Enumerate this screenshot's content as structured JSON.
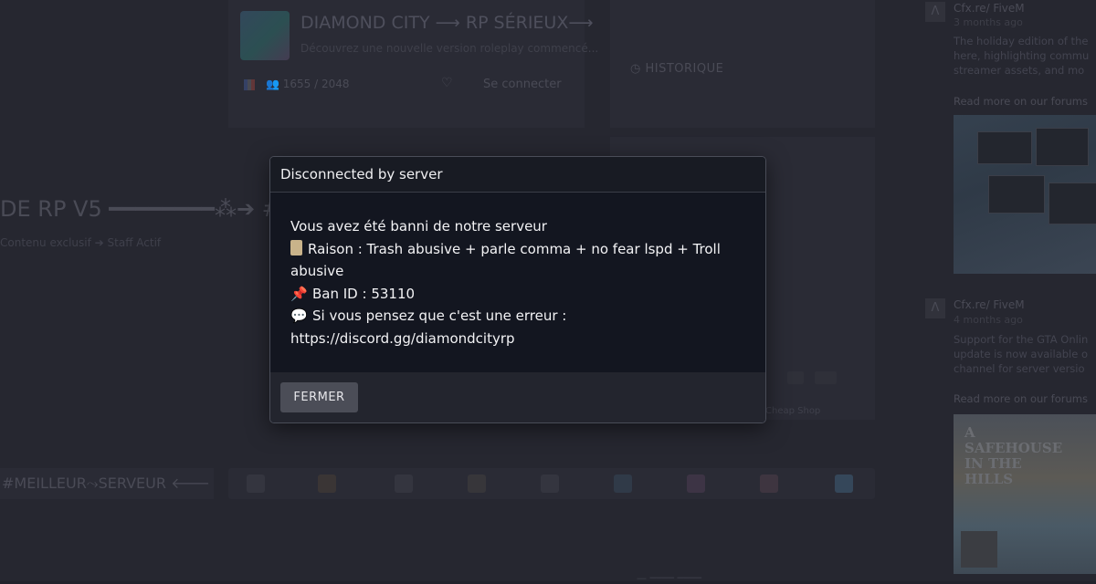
{
  "background": {
    "server": {
      "title": "DIAMOND CITY ⟶ RP SÉRIEUX⟶",
      "subtitle": "Découvrez une nouvelle version roleplay commencé...",
      "players": "1655 / 2048",
      "connect_label": "Se connecter",
      "history_label": "HISTORIQUE"
    },
    "banner": {
      "headline": "DE RP V5 ━━━━━━━━⁂➔ #",
      "subline": "Contenu exclusif ➔ Staff Actif"
    },
    "best_label": "#MEILLEUR⤳SERVEUR 🡐",
    "cheap_shop": "Cheap Shop",
    "bottom_text": "— ──── ────",
    "news": [
      {
        "author": "Cfx.re/ FiveM",
        "time": "3 months ago",
        "body": "The holiday edition of the\nhere, highlighting commu\nstreamer assets, and mo",
        "link": "Read more on our forums"
      },
      {
        "author": "Cfx.re/ FiveM",
        "time": "4 months ago",
        "body": "Support for the GTA Onlin\nupdate is now available o\nchannel for server versio",
        "link": "Read more on our forums"
      }
    ],
    "news_image_text": "A\nSAFEHOUSE\nIN THE\nHILLS"
  },
  "modal": {
    "title": "Disconnected by server",
    "line1": "Vous avez été banni de notre serveur",
    "reason": "Raison : Trash abusive + parle comma + no fear lspd + Troll abusive",
    "ban_id": "Ban ID : 53110",
    "appeal": "Si vous pensez que c'est une erreur :",
    "url": "https://discord.gg/diamondcityrp",
    "close_label": "FERMER",
    "icons": [
      "clipboard-icon",
      "pushpin-icon",
      "speech-bubble-icon"
    ]
  }
}
